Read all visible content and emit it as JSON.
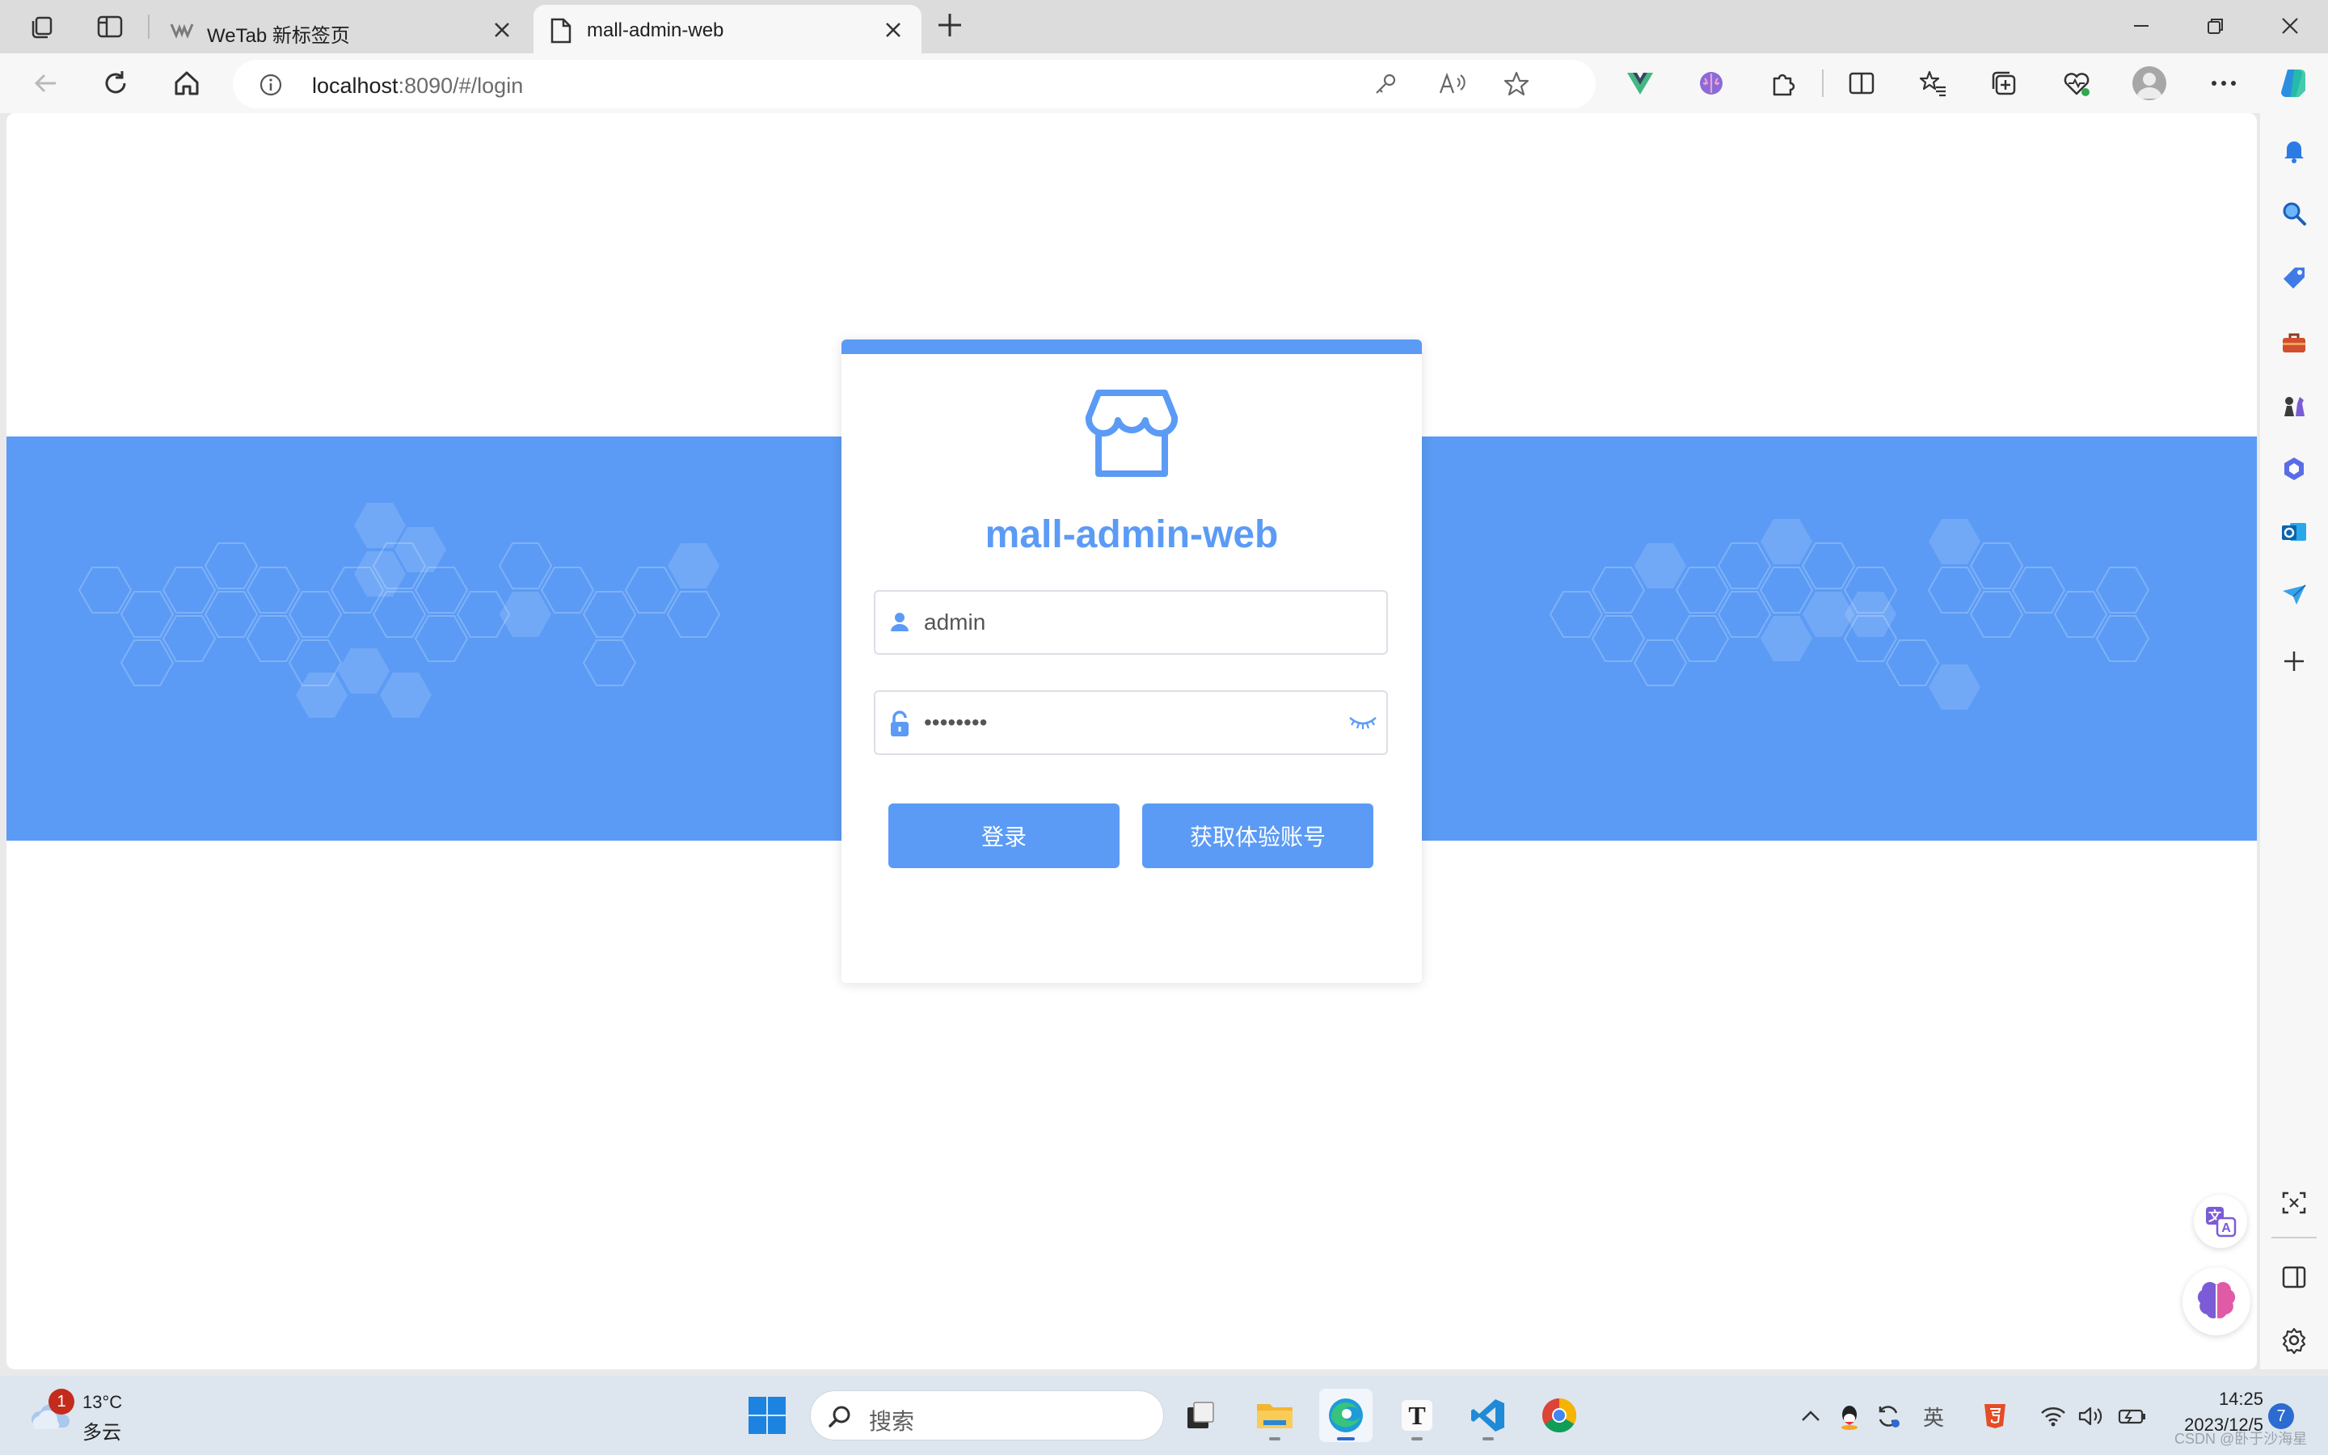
{
  "browser": {
    "tabs": [
      {
        "title": "WeTab 新标签页"
      },
      {
        "title": "mall-admin-web"
      }
    ],
    "address": {
      "host": "localhost",
      "rest": ":8090/#/login"
    }
  },
  "login": {
    "app_title": "mall-admin-web",
    "username": {
      "value": "admin"
    },
    "password": {
      "value": "••••••••"
    },
    "login_button": "登录",
    "demo_button": "获取体验账号"
  },
  "colors": {
    "accent": "#5b9bf5",
    "taskbar": "#dde6ee"
  },
  "taskbar": {
    "weather": {
      "badge": "1",
      "temp": "13°C",
      "condition": "多云"
    },
    "search_placeholder": "搜索",
    "tray_lang": "英",
    "clock": {
      "time": "14:25",
      "date": "2023/12/5"
    },
    "notification_count": "7"
  },
  "watermark": "CSDN @卧于沙海星"
}
